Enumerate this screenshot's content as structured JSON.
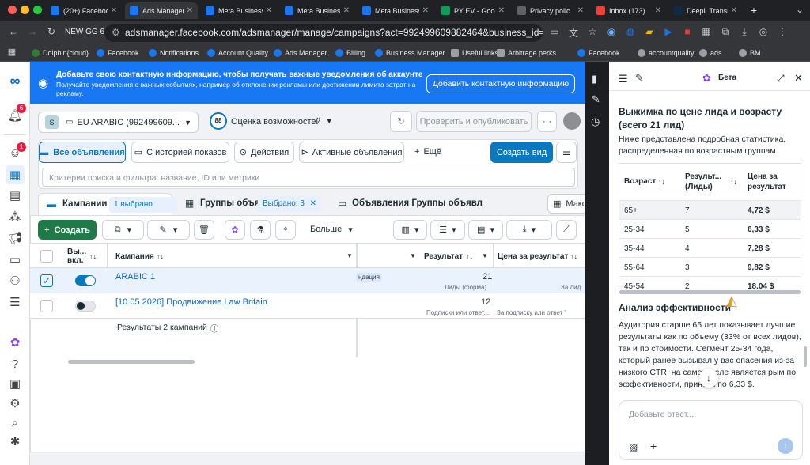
{
  "tabs": [
    {
      "label": "(20+) Facebook",
      "color": "#1877f2",
      "active": false
    },
    {
      "label": "Ads Manager",
      "color": "#1877f2",
      "active": true
    },
    {
      "label": "Meta Business",
      "color": "#1877f2",
      "active": false
    },
    {
      "label": "Meta Business",
      "color": "#1877f2",
      "active": false
    },
    {
      "label": "Meta Business",
      "color": "#1877f2",
      "active": false
    },
    {
      "label": "PY EV - Goog",
      "color": "#0f9d58",
      "active": false
    },
    {
      "label": "Privacy polic",
      "color": "#5f6368",
      "active": false
    },
    {
      "label": "Inbox (173)",
      "color": "#ea4335",
      "active": false
    },
    {
      "label": "DeepL Transl",
      "color": "#0f2b46",
      "active": false
    }
  ],
  "browser": {
    "profile": "NEW GG 6",
    "url": "adsmanager.facebook.com/adsmanager/manage/campaigns?act=992499609882464&business_id=1487901...",
    "bookmarks": [
      "Dolphin{cloud}",
      "Facebook",
      "Notifications",
      "Account Quality",
      "Ads Manager",
      "Billing",
      "Business Manager",
      "Useful links",
      "Arbitrage perks",
      "Facebook",
      "accountquality",
      "ads",
      "BM"
    ]
  },
  "nav": {
    "notifications_badge": "6",
    "messages_badge": "1"
  },
  "banner": {
    "title": "Добавьте свою контактную информацию, чтобы получать важные уведомления об аккаунте",
    "text": "Получайте уведомления о важных событиях, например об отклонении рекламы или достижении лимита затрат на рекламу.",
    "button": "Добавить контактную информацию"
  },
  "account": {
    "initial": "S",
    "name": "EU ARABIC (992499609...",
    "score": "88",
    "score_label": "Оценка возможностей",
    "publish": "Проверить и опубликовать"
  },
  "filters": {
    "all_ads": "Все объявления",
    "history": "С историей показов",
    "actions": "Действия",
    "active": "Активные объявления",
    "more": "Ещё",
    "create_view": "Создать вид",
    "search_placeholder": "Критерии поиска и фильтра: название, ID или метрики"
  },
  "level_tabs": {
    "campaigns": "Кампании",
    "campaigns_selected": "1 выбрано",
    "adsets": "Группы объя",
    "adsets_selected": "Выбрано: 3",
    "ads": "Объявления Группы объявл",
    "more": "Макс"
  },
  "toolbar": {
    "create": "Создать",
    "more": "Больше"
  },
  "table": {
    "col_toggle": "Вы... вкл.",
    "col_campaign": "Кампания",
    "col_result": "Результат",
    "col_cpr": "Цена за результат",
    "rows": [
      {
        "name": "ARABIC 1",
        "on": true,
        "checked": true,
        "delivery": "ндация",
        "result": "21",
        "result_sub": "Лиды (форма)",
        "cpr_sub": "За лид"
      },
      {
        "name": "[10.05.2026] Продвижение Law Britain",
        "on": false,
        "checked": false,
        "delivery": "",
        "result": "12",
        "result_sub": "Подписки или ответ...",
        "cpr_sub": "За подписку или ответ \""
      }
    ],
    "footer": "Результаты 2 кампаний"
  },
  "panel": {
    "beta": "Бета",
    "heading": "Выжимка по цене лида и возрасту (всего 21 лид)",
    "intro": "Ниже представлена подробная статистика, распределенная по возрастным группам.",
    "col_age": "Возраст",
    "col_results": "Результ... (Лиды)",
    "col_cost": "Цена за результат",
    "rows": [
      {
        "age": "65+",
        "results": "7",
        "cost": "4,72 $"
      },
      {
        "age": "25-34",
        "results": "5",
        "cost": "6,33 $"
      },
      {
        "age": "35-44",
        "results": "4",
        "cost": "7,28 $"
      },
      {
        "age": "55-64",
        "results": "3",
        "cost": "9,82 $"
      },
      {
        "age": "45-54",
        "results": "2",
        "cost": "18,04 $"
      }
    ],
    "analysis_title": "Анализ эффективности",
    "analysis_text": "Аудитория старше 65 лет показывает лучшие результаты как по объему (33% от всех лидов), так и по стоимости. Сегмент 25-34 года, который ранее вызывал у вас опасения из-за низкого CTR, на самом деле является   рым по эффективности, прино    ы по 6,33 $.",
    "input_placeholder": "Добавьте ответ..."
  },
  "colors": {
    "fb_blue": "#1877f2",
    "create_green": "#1e7b47",
    "toggle_on": "#0a78be",
    "chrome_dark": "#202124"
  }
}
